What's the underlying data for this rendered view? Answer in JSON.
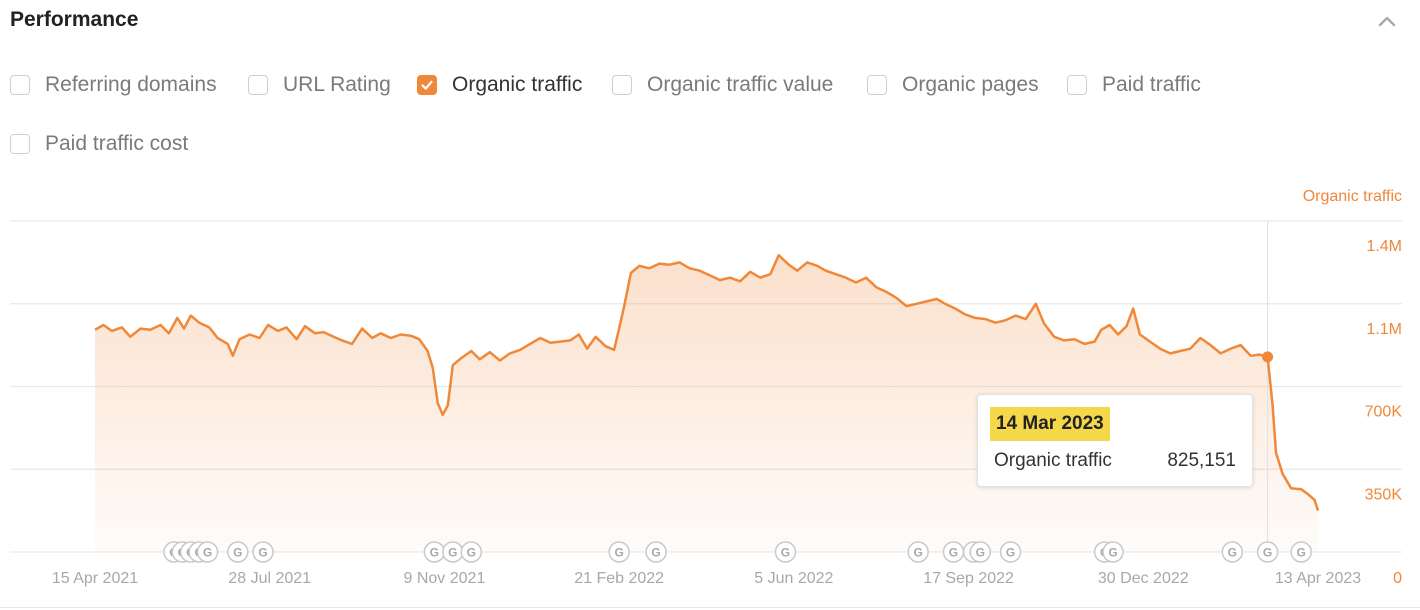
{
  "header": {
    "title": "Performance",
    "collapse_icon": "chevron-up-icon"
  },
  "filters": [
    {
      "label": "Referring domains",
      "checked": false
    },
    {
      "label": "URL Rating",
      "checked": false
    },
    {
      "label": "Organic traffic",
      "checked": true
    },
    {
      "label": "Organic traffic value",
      "checked": false
    },
    {
      "label": "Organic pages",
      "checked": false
    },
    {
      "label": "Paid traffic",
      "checked": false
    },
    {
      "label": "Paid traffic cost",
      "checked": false
    }
  ],
  "colors": {
    "accent": "#f0883a",
    "fill": "#fbe3cf",
    "grid": "#e8e8e8",
    "axis_text": "#a8a8a8",
    "tooltip_highlight": "#f5d84a"
  },
  "tooltip": {
    "date": "14 Mar 2023",
    "label": "Organic traffic",
    "value": "825,151"
  },
  "chart_data": {
    "type": "area",
    "title": "",
    "series_label": "Organic traffic",
    "xlabel": "",
    "ylabel": "Organic traffic",
    "ylim": [
      0,
      1400000
    ],
    "y_ticks": [
      {
        "value": 0,
        "label": "0"
      },
      {
        "value": 350000,
        "label": "350K"
      },
      {
        "value": 700000,
        "label": "700K"
      },
      {
        "value": 1050000,
        "label": "1.1M"
      },
      {
        "value": 1400000,
        "label": "1.4M"
      }
    ],
    "x_range": [
      "2021-04-15",
      "2023-04-13"
    ],
    "x_ticks": [
      "15 Apr 2021",
      "28 Jul 2021",
      "9 Nov 2021",
      "21 Feb 2022",
      "5 Jun 2022",
      "17 Sep 2022",
      "30 Dec 2022",
      "13 Apr 2023"
    ],
    "grid": true,
    "legend": "top-right",
    "highlight": {
      "date": "2023-03-14",
      "value": 825151
    },
    "google_update_markers": [
      "2021-06-01",
      "2021-06-06",
      "2021-06-11",
      "2021-06-16",
      "2021-06-21",
      "2021-07-09",
      "2021-07-24",
      "2021-11-03",
      "2021-11-14",
      "2021-11-25",
      "2022-02-21",
      "2022-03-15",
      "2022-05-31",
      "2022-08-18",
      "2022-09-08",
      "2022-09-20",
      "2022-09-24",
      "2022-10-12",
      "2022-12-07",
      "2022-12-12",
      "2023-02-21",
      "2023-03-14",
      "2023-04-03"
    ],
    "points": [
      [
        "2021-04-15",
        940000
      ],
      [
        "2021-04-20",
        960000
      ],
      [
        "2021-04-25",
        935000
      ],
      [
        "2021-05-01",
        950000
      ],
      [
        "2021-05-06",
        910000
      ],
      [
        "2021-05-12",
        945000
      ],
      [
        "2021-05-18",
        940000
      ],
      [
        "2021-05-24",
        960000
      ],
      [
        "2021-05-29",
        925000
      ],
      [
        "2021-06-03",
        990000
      ],
      [
        "2021-06-07",
        945000
      ],
      [
        "2021-06-11",
        1000000
      ],
      [
        "2021-06-16",
        970000
      ],
      [
        "2021-06-22",
        950000
      ],
      [
        "2021-06-27",
        905000
      ],
      [
        "2021-07-03",
        880000
      ],
      [
        "2021-07-06",
        830000
      ],
      [
        "2021-07-10",
        900000
      ],
      [
        "2021-07-16",
        920000
      ],
      [
        "2021-07-22",
        905000
      ],
      [
        "2021-07-27",
        960000
      ],
      [
        "2021-08-02",
        935000
      ],
      [
        "2021-08-07",
        950000
      ],
      [
        "2021-08-13",
        900000
      ],
      [
        "2021-08-18",
        955000
      ],
      [
        "2021-08-24",
        925000
      ],
      [
        "2021-08-29",
        930000
      ],
      [
        "2021-09-04",
        910000
      ],
      [
        "2021-09-09",
        895000
      ],
      [
        "2021-09-15",
        880000
      ],
      [
        "2021-09-21",
        945000
      ],
      [
        "2021-09-27",
        905000
      ],
      [
        "2021-10-02",
        925000
      ],
      [
        "2021-10-08",
        905000
      ],
      [
        "2021-10-14",
        920000
      ],
      [
        "2021-10-20",
        915000
      ],
      [
        "2021-10-25",
        900000
      ],
      [
        "2021-10-30",
        850000
      ],
      [
        "2021-11-02",
        780000
      ],
      [
        "2021-11-05",
        630000
      ],
      [
        "2021-11-08",
        580000
      ],
      [
        "2021-11-11",
        620000
      ],
      [
        "2021-11-14",
        790000
      ],
      [
        "2021-11-19",
        820000
      ],
      [
        "2021-11-25",
        850000
      ],
      [
        "2021-11-30",
        815000
      ],
      [
        "2021-12-06",
        845000
      ],
      [
        "2021-12-12",
        810000
      ],
      [
        "2021-12-18",
        840000
      ],
      [
        "2021-12-24",
        855000
      ],
      [
        "2021-12-30",
        880000
      ],
      [
        "2022-01-05",
        905000
      ],
      [
        "2022-01-11",
        885000
      ],
      [
        "2022-01-17",
        890000
      ],
      [
        "2022-01-23",
        895000
      ],
      [
        "2022-01-28",
        920000
      ],
      [
        "2022-02-02",
        860000
      ],
      [
        "2022-02-07",
        910000
      ],
      [
        "2022-02-13",
        870000
      ],
      [
        "2022-02-18",
        855000
      ],
      [
        "2022-02-21",
        945000
      ],
      [
        "2022-02-24",
        1040000
      ],
      [
        "2022-02-28",
        1180000
      ],
      [
        "2022-03-05",
        1210000
      ],
      [
        "2022-03-11",
        1200000
      ],
      [
        "2022-03-17",
        1220000
      ],
      [
        "2022-03-23",
        1215000
      ],
      [
        "2022-03-29",
        1225000
      ],
      [
        "2022-04-04",
        1200000
      ],
      [
        "2022-04-10",
        1190000
      ],
      [
        "2022-04-16",
        1170000
      ],
      [
        "2022-04-22",
        1150000
      ],
      [
        "2022-04-28",
        1160000
      ],
      [
        "2022-05-04",
        1145000
      ],
      [
        "2022-05-10",
        1185000
      ],
      [
        "2022-05-16",
        1160000
      ],
      [
        "2022-05-22",
        1175000
      ],
      [
        "2022-05-27",
        1255000
      ],
      [
        "2022-06-02",
        1215000
      ],
      [
        "2022-06-07",
        1190000
      ],
      [
        "2022-06-13",
        1225000
      ],
      [
        "2022-06-19",
        1210000
      ],
      [
        "2022-06-24",
        1190000
      ],
      [
        "2022-06-30",
        1175000
      ],
      [
        "2022-07-06",
        1160000
      ],
      [
        "2022-07-12",
        1140000
      ],
      [
        "2022-07-18",
        1160000
      ],
      [
        "2022-07-24",
        1120000
      ],
      [
        "2022-07-30",
        1100000
      ],
      [
        "2022-08-05",
        1075000
      ],
      [
        "2022-08-11",
        1040000
      ],
      [
        "2022-08-17",
        1050000
      ],
      [
        "2022-08-23",
        1060000
      ],
      [
        "2022-08-29",
        1070000
      ],
      [
        "2022-09-03",
        1050000
      ],
      [
        "2022-09-09",
        1030000
      ],
      [
        "2022-09-15",
        1005000
      ],
      [
        "2022-09-21",
        990000
      ],
      [
        "2022-09-27",
        985000
      ],
      [
        "2022-10-03",
        970000
      ],
      [
        "2022-10-09",
        980000
      ],
      [
        "2022-10-15",
        1000000
      ],
      [
        "2022-10-21",
        985000
      ],
      [
        "2022-10-27",
        1050000
      ],
      [
        "2022-11-01",
        965000
      ],
      [
        "2022-11-07",
        910000
      ],
      [
        "2022-11-13",
        895000
      ],
      [
        "2022-11-19",
        900000
      ],
      [
        "2022-11-25",
        880000
      ],
      [
        "2022-12-01",
        890000
      ],
      [
        "2022-12-05",
        940000
      ],
      [
        "2022-12-10",
        960000
      ],
      [
        "2022-12-15",
        920000
      ],
      [
        "2022-12-20",
        955000
      ],
      [
        "2022-12-24",
        1030000
      ],
      [
        "2022-12-28",
        920000
      ],
      [
        "2023-01-03",
        890000
      ],
      [
        "2023-01-09",
        860000
      ],
      [
        "2023-01-15",
        840000
      ],
      [
        "2023-01-21",
        850000
      ],
      [
        "2023-01-27",
        860000
      ],
      [
        "2023-02-02",
        905000
      ],
      [
        "2023-02-08",
        875000
      ],
      [
        "2023-02-14",
        840000
      ],
      [
        "2023-02-20",
        860000
      ],
      [
        "2023-02-26",
        875000
      ],
      [
        "2023-03-04",
        830000
      ],
      [
        "2023-03-09",
        835000
      ],
      [
        "2023-03-14",
        825151
      ],
      [
        "2023-03-17",
        620000
      ],
      [
        "2023-03-19",
        420000
      ],
      [
        "2023-03-23",
        330000
      ],
      [
        "2023-03-28",
        270000
      ],
      [
        "2023-04-03",
        265000
      ],
      [
        "2023-04-07",
        245000
      ],
      [
        "2023-04-11",
        220000
      ],
      [
        "2023-04-13",
        175000
      ]
    ]
  }
}
